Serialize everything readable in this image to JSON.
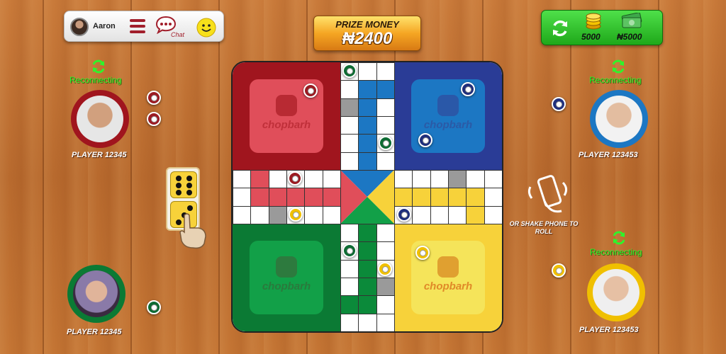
{
  "profile": {
    "name": "Aaron",
    "chat_label": "Chat"
  },
  "prize": {
    "title": "PRIZE MONEY",
    "amount": "₦2400"
  },
  "wallet": {
    "coins": "5000",
    "cash": "₦5000"
  },
  "board": {
    "logo_text": "chopbarh",
    "colors": {
      "red": "#9b1b22",
      "green": "#0d6b33",
      "blue": "#1f2f7c",
      "yellow": "#f0c000"
    }
  },
  "players": {
    "top_left": {
      "name": "PLAYER 12345",
      "status": "Reconnecting"
    },
    "top_right": {
      "name": "PLAYER 123453",
      "status": "Reconnecting"
    },
    "bottom_left": {
      "name": "PLAYER 12345"
    },
    "bottom_right": {
      "name": "PLAYER 123453",
      "status": "Reconnecting"
    }
  },
  "dice": {
    "top_value": 6,
    "bottom_value": 3
  },
  "shake_hint": "OR SHAKE PHONE TO ROLL"
}
